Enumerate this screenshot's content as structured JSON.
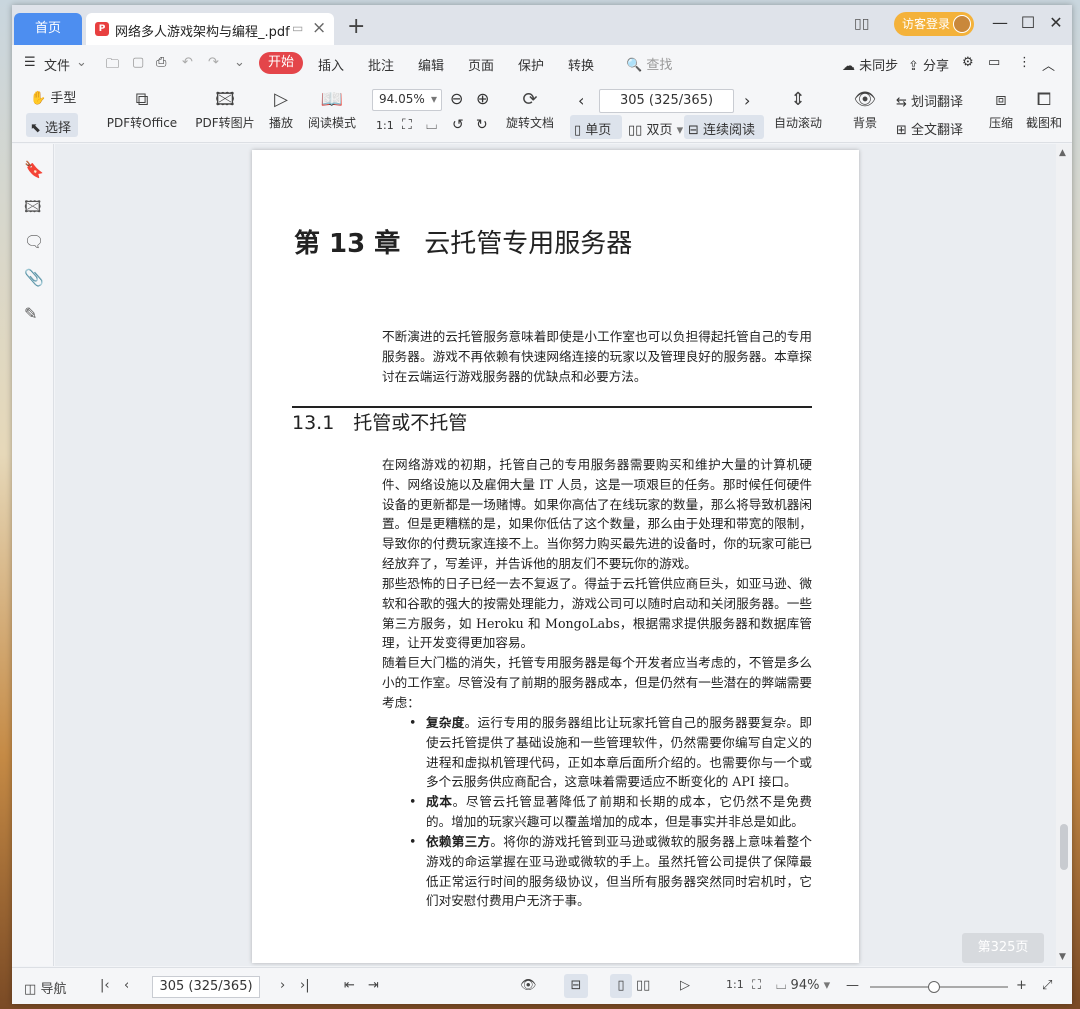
{
  "titlebar": {
    "home_tab": "首页",
    "doc_tab_title": "网络多人游戏架构与编程_.pdf",
    "new_tab": "+",
    "login_label": "访客登录",
    "pdf_icon_letter": "P"
  },
  "menubar": {
    "file": "文件",
    "start": "开始",
    "items": [
      "插入",
      "批注",
      "编辑",
      "页面",
      "保护",
      "转换"
    ],
    "search_placeholder": "查找",
    "sync": "未同步",
    "share": "分享"
  },
  "toolbar": {
    "hand": "手型",
    "select": "选择",
    "pdf_to_office": "PDF转Office",
    "pdf_to_image": "PDF转图片",
    "play": "播放",
    "read_mode": "阅读模式",
    "zoom": "94.05%",
    "rotate_doc": "旋转文档",
    "page_indicator": "305 (325/365)",
    "single": "单页",
    "double": "双页",
    "continuous": "连续阅读",
    "auto_scroll": "自动滚动",
    "background": "背景",
    "word_translate": "划词翻译",
    "full_translate": "全文翻译",
    "compress": "压缩",
    "screenshot": "截图和"
  },
  "document": {
    "chapter_num": "第 13 章",
    "chapter_title": "云托管专用服务器",
    "intro": "不断演进的云托管服务意味着即使是小工作室也可以负担得起托管自己的专用服务器。游戏不再依赖有快速网络连接的玩家以及管理良好的服务器。本章探讨在云端运行游戏服务器的优缺点和必要方法。",
    "section": "13.1　托管或不托管",
    "p1": "在网络游戏的初期，托管自己的专用服务器需要购买和维护大量的计算机硬件、网络设施以及雇佣大量 IT 人员，这是一项艰巨的任务。那时候任何硬件设备的更新都是一场赌博。如果你高估了在线玩家的数量，那么将导致机器闲置。但是更糟糕的是，如果你低估了这个数量，那么由于处理和带宽的限制，导致你的付费玩家连接不上。当你努力购买最先进的设备时，你的玩家可能已经放弃了，写差评，并告诉他的朋友们不要玩你的游戏。",
    "p2": "那些恐怖的日子已经一去不复返了。得益于云托管供应商巨头，如亚马逊、微软和谷歌的强大的按需处理能力，游戏公司可以随时启动和关闭服务器。一些第三方服务，如 Heroku 和 MongoLabs，根据需求提供服务器和数据库管理，让开发变得更加容易。",
    "p3": "随着巨大门槛的消失，托管专用服务器是每个开发者应当考虑的，不管是多么小的工作室。尽管没有了前期的服务器成本，但是仍然有一些潜在的弊端需要考虑：",
    "bullets": [
      {
        "term": "复杂度",
        "text": "。运行专用的服务器组比让玩家托管自己的服务器要复杂。即使云托管提供了基础设施和一些管理软件，仍然需要你编写自定义的进程和虚拟机管理代码，正如本章后面所介绍的。也需要你与一个或多个云服务供应商配合，这意味着需要适应不断变化的 API 接口。"
      },
      {
        "term": "成本",
        "text": "。尽管云托管显著降低了前期和长期的成本，它仍然不是免费的。增加的玩家兴趣可以覆盖增加的成本，但是事实并非总是如此。"
      },
      {
        "term": "依赖第三方",
        "text": "。将你的游戏托管到亚马逊或微软的服务器上意味着整个游戏的命运掌握在亚马逊或微软的手上。虽然托管公司提供了保障最低正常运行时间的服务级协议，但当所有服务器突然同时宕机时，它们对安慰付费用户无济于事。"
      }
    ]
  },
  "page_badge": "第325页",
  "statusbar": {
    "nav": "导航",
    "page_indicator": "305 (325/365)",
    "zoom": "94%"
  },
  "colors": {
    "accent": "#4d8ef0",
    "start_pill": "#e4454a",
    "login": "#f4b23a"
  }
}
